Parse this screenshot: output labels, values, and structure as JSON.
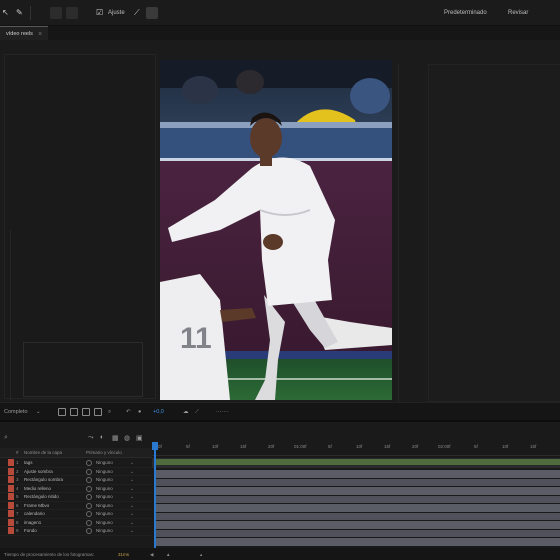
{
  "toolbar": {
    "snap_label": "Ajuste",
    "workspace_tabs": [
      "Predeterminado",
      "Revisar"
    ]
  },
  "composition_tab": {
    "label": "vídeo reels"
  },
  "view_controls": {
    "magnification": "Completo",
    "exposure": "+0,0"
  },
  "timeline": {
    "header_cols": [
      "#",
      "Nombre de la capa",
      "Primario y vínculo"
    ],
    "ruler_ticks": [
      "0f",
      "5f",
      "10f",
      "15f",
      "20f",
      "01:00f",
      "5f",
      "10f",
      "15f",
      "20f",
      "02:00f",
      "5f",
      "10f",
      "15f"
    ],
    "layers": [
      {
        "num": "1",
        "name": "tags",
        "parent": "Ninguno"
      },
      {
        "num": "2",
        "name": "Ajuste sombra",
        "parent": "Ninguno"
      },
      {
        "num": "3",
        "name": "Rectángulo sombra",
        "parent": "Ninguno"
      },
      {
        "num": "4",
        "name": "Medio relleno",
        "parent": "Ninguno"
      },
      {
        "num": "5",
        "name": "Rectángulo nitido",
        "parent": "Ninguno"
      },
      {
        "num": "6",
        "name": "Frame Mbvo",
        "parent": "Ninguno"
      },
      {
        "num": "7",
        "name": "calendario",
        "parent": "Ninguno"
      },
      {
        "num": "8",
        "name": "imagen1",
        "parent": "Ninguno"
      },
      {
        "num": "9",
        "name": "Fondo",
        "parent": "Ninguno"
      }
    ],
    "footer_text": "Tiempo de procesamiento de los fotogramas:",
    "footer_value": "31ms"
  },
  "colors": {
    "accent": "#2a79d0",
    "label_red": "#b84a3b",
    "work_area": "#4e6c3d"
  }
}
